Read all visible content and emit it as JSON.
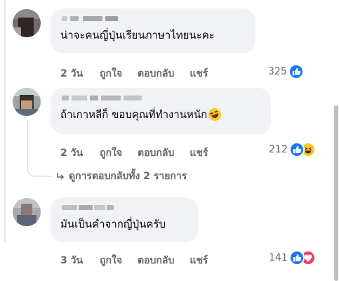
{
  "comments": [
    {
      "text": "น่าจะคนญี่ปุ่นเรียนภาษาไทยนะคะ",
      "time": "2 วัน",
      "like": "ถูกใจ",
      "reply": "ตอบกลับ",
      "share": "แชร์",
      "reaction_count": "325",
      "reactions": [
        "like-icon"
      ]
    },
    {
      "text": "ถ้าเกาหลีก็ ขอบคุณที่ทำงานหนัก",
      "emoji": "rolling-laugh-emoji",
      "time": "2 วัน",
      "like": "ถูกใจ",
      "reply": "ตอบกลับ",
      "share": "แชร์",
      "reaction_count": "212",
      "reactions": [
        "like-icon",
        "haha-icon"
      ]
    },
    {
      "text": "มันเป็นคำจากญี่ปุ่นครับ",
      "time": "3 วัน",
      "like": "ถูกใจ",
      "reply": "ตอบกลับ",
      "share": "แชร์",
      "reaction_count": "141",
      "reactions": [
        "like-icon",
        "love-icon"
      ]
    }
  ],
  "view_replies": "ดูการตอบกลับทั้ง 2 รายการ",
  "colors": {
    "bubble": "#f0f2f5",
    "meta_text": "#65676b",
    "like_blue": "#1877f2",
    "love_red": "#f33e58",
    "haha_yellow": "#f7c928"
  }
}
